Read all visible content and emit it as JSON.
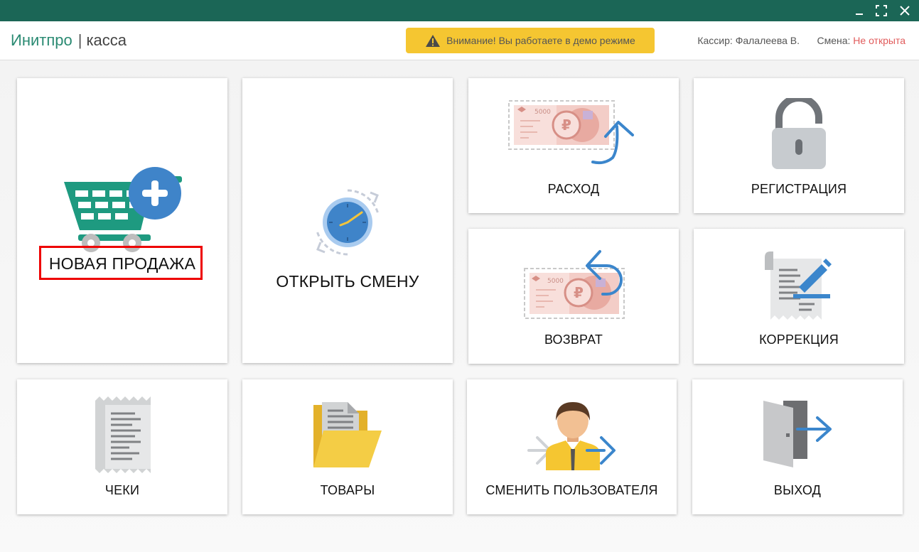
{
  "window": {
    "controls": [
      "minimize",
      "maximize",
      "close"
    ]
  },
  "header": {
    "brand_name": "Инитпро",
    "brand_separator": "|",
    "brand_product": "касса",
    "demo_warning": "Внимание! Вы работаете в демо режиме",
    "cashier_label": "Кассир:",
    "cashier_name": "Фалалеева В.",
    "shift_label": "Смена:",
    "shift_status": "Не открыта"
  },
  "tiles": {
    "new_sale": "НОВАЯ ПРОДАЖА",
    "open_shift": "ОТКРЫТЬ СМЕНУ",
    "expense": "РАСХОД",
    "registration": "РЕГИСТРАЦИЯ",
    "refund": "ВОЗВРАТ",
    "correction": "КОРРЕКЦИЯ",
    "receipts": "ЧЕКИ",
    "goods": "ТОВАРЫ",
    "switch_user": "СМЕНИТЬ ПОЛЬЗОВАТЕЛЯ",
    "exit": "ВЫХОД"
  },
  "banknote_denomination": "5000",
  "colors": {
    "titlebar": "#1b6656",
    "brand": "#2a8a72",
    "demo_banner": "#f5c631",
    "shift_closed": "#e15b5b",
    "highlight": "#ee0000",
    "cart": "#1e9a80",
    "accent_blue": "#3b86cc"
  },
  "icons": {
    "new_sale": "shopping-cart-plus-icon",
    "open_shift": "clock-refresh-icon",
    "expense": "banknote-arrow-up-icon",
    "registration": "padlock-icon",
    "refund": "banknote-arrow-back-icon",
    "correction": "document-edit-icon",
    "receipts": "receipt-icon",
    "goods": "folder-documents-icon",
    "switch_user": "user-switch-icon",
    "exit": "exit-door-icon"
  }
}
